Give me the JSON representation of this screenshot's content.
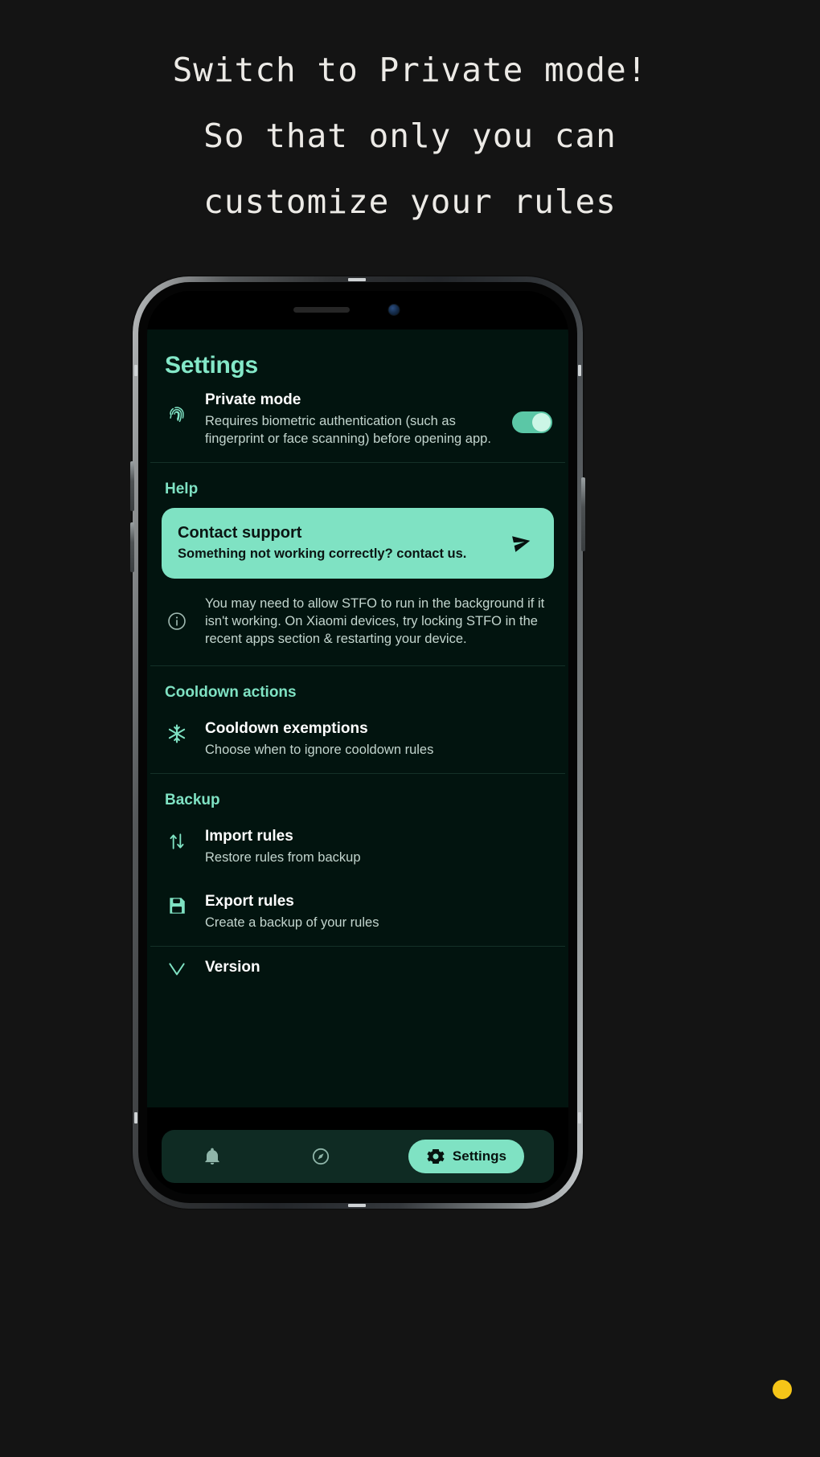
{
  "headline": {
    "line1": "Switch to Private mode!",
    "line2": "So that only you can",
    "line3": "customize your rules"
  },
  "colors": {
    "page_bg": "#141414",
    "app_bg": "#02140f",
    "accent": "#7fe2c3",
    "accent_strong": "#84e8c8",
    "title_text": "#ffffff",
    "sub_text": "#c3d5ce",
    "nav_bg": "#0f2b23",
    "dot": "#f5c518"
  },
  "app": {
    "title": "Settings",
    "private_mode": {
      "icon": "fingerprint-icon",
      "title": "Private mode",
      "description": "Requires biometric authentication (such as fingerprint or face scanning) before opening app.",
      "toggle_on": true
    },
    "help": {
      "header": "Help",
      "card": {
        "title": "Contact support",
        "description": "Something not working correctly? contact us.",
        "icon": "send-icon"
      },
      "note": {
        "icon": "info-icon",
        "text": "You may need to allow STFO to run in the background if it isn't working. On Xiaomi devices, try locking STFO in the recent apps section & restarting your device."
      }
    },
    "cooldown": {
      "header": "Cooldown actions",
      "item": {
        "icon": "snowflake-icon",
        "title": "Cooldown exemptions",
        "description": "Choose when to ignore cooldown rules"
      }
    },
    "backup": {
      "header": "Backup",
      "import": {
        "icon": "import-arrows-icon",
        "title": "Import rules",
        "description": "Restore rules from backup"
      },
      "export": {
        "icon": "save-disk-icon",
        "title": "Export rules",
        "description": "Create a backup of your rules"
      }
    },
    "version": {
      "icon": "tag-icon",
      "title": "Version"
    },
    "bottom_nav": [
      {
        "icon": "bell-icon",
        "label": "",
        "active": false
      },
      {
        "icon": "compass-icon",
        "label": "",
        "active": false
      },
      {
        "icon": "gear-icon",
        "label": "Settings",
        "active": true
      }
    ]
  }
}
